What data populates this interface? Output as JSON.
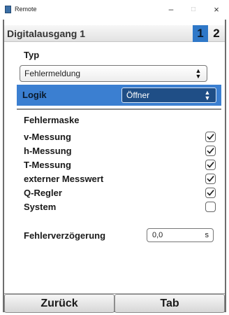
{
  "window": {
    "title": "Remote",
    "minimize_glyph": "–",
    "maximize_glyph": "□",
    "close_glyph": "×"
  },
  "header": {
    "title": "Digitalausgang 1",
    "tabs": [
      "1",
      "2"
    ],
    "active_tab": "1"
  },
  "typ": {
    "label": "Typ",
    "selected": "Fehlermeldung",
    "arrow_glyph": "▲▼"
  },
  "logik": {
    "label": "Logik",
    "selected": "Öffner",
    "arrow_glyph": "▲▼"
  },
  "fehlermaske": {
    "label": "Fehlermaske",
    "items": [
      {
        "label": "v-Messung",
        "checked": true
      },
      {
        "label": "h-Messung",
        "checked": true
      },
      {
        "label": "T-Messung",
        "checked": true
      },
      {
        "label": "externer Messwert",
        "checked": true
      },
      {
        "label": "Q-Regler",
        "checked": true
      },
      {
        "label": "System",
        "checked": false
      }
    ]
  },
  "fehlerverzoegerung": {
    "label": "Fehlerverzögerung",
    "value": "0,0",
    "unit": "s"
  },
  "footer": {
    "back_label": "Zurück",
    "tab_label": "Tab"
  },
  "colors": {
    "accent": "#3b7fd1",
    "dropdown_dark": "#1f4e86",
    "tab_active": "#2f78c8"
  }
}
